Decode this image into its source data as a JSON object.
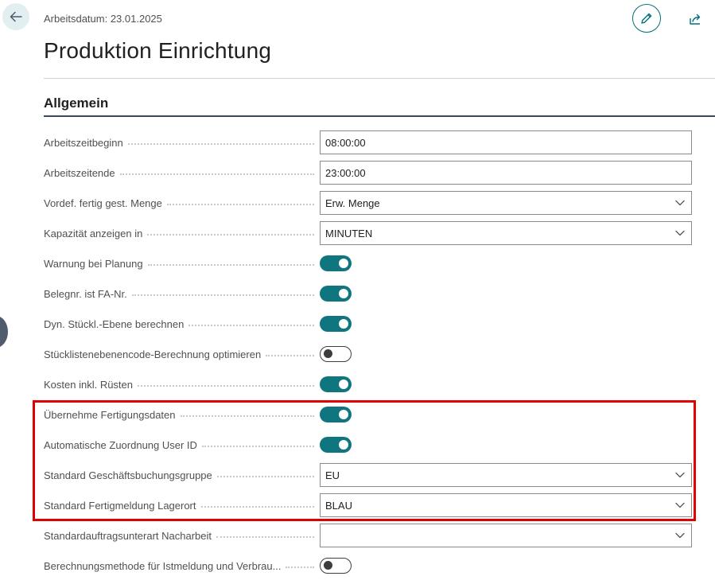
{
  "header": {
    "work_date": "Arbeitsdatum: 23.01.2025",
    "title": "Produktion Einrichtung"
  },
  "section": {
    "title": "Allgemein"
  },
  "fields": [
    {
      "label": "Arbeitszeitbeginn",
      "type": "text",
      "value": "08:00:00"
    },
    {
      "label": "Arbeitszeitende",
      "type": "text",
      "value": "23:00:00"
    },
    {
      "label": "Vordef. fertig gest. Menge",
      "type": "select",
      "value": "Erw. Menge"
    },
    {
      "label": "Kapazität anzeigen in",
      "type": "select",
      "value": "MINUTEN"
    },
    {
      "label": "Warnung bei Planung",
      "type": "toggle",
      "value": true
    },
    {
      "label": "Belegnr. ist FA-Nr.",
      "type": "toggle",
      "value": true
    },
    {
      "label": "Dyn. Stückl.-Ebene berechnen",
      "type": "toggle",
      "value": true
    },
    {
      "label": "Stücklistenebenencode-Berechnung optimieren",
      "type": "toggle",
      "value": false
    },
    {
      "label": "Kosten inkl. Rüsten",
      "type": "toggle",
      "value": true
    },
    {
      "label": "Übernehme Fertigungsdaten",
      "type": "toggle",
      "value": true
    },
    {
      "label": "Automatische Zuordnung User ID",
      "type": "toggle",
      "value": true
    },
    {
      "label": "Standard Geschäftsbuchungsgruppe",
      "type": "select",
      "value": "EU"
    },
    {
      "label": "Standard Fertigmeldung Lagerort",
      "type": "select",
      "value": "BLAU"
    },
    {
      "label": "Standardauftragsunterart Nacharbeit",
      "type": "select",
      "value": ""
    },
    {
      "label": "Berechnungsmethode für Istmeldung und Verbrau...",
      "type": "toggle",
      "value": false
    }
  ],
  "icons": {
    "back": "arrow-left-icon",
    "edit": "pencil-icon",
    "share": "share-icon",
    "dropdown": "chevron-down-icon"
  },
  "colors": {
    "accent": "#0f7680",
    "highlight": "#e00000"
  }
}
